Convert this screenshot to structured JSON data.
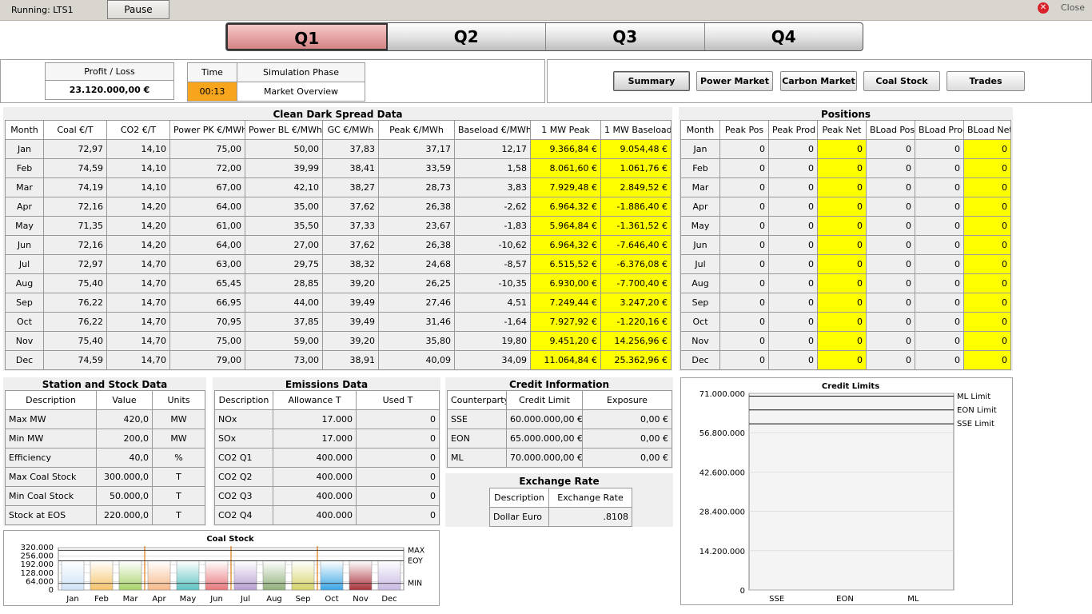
{
  "topbar": {
    "running_label": "Running:",
    "running_value": "LTS1",
    "pause_label": "Pause",
    "close_label": "Close"
  },
  "quarters": [
    "Q1",
    "Q2",
    "Q3",
    "Q4"
  ],
  "active_quarter": "Q1",
  "status": {
    "profit_label": "Profit / Loss",
    "profit_value": "23.120.000,00 €",
    "time_label": "Time",
    "time_value": "00:13",
    "phase_label": "Simulation Phase",
    "phase_value": "Market Overview"
  },
  "nav": [
    "Summary",
    "Power Market",
    "Carbon Market",
    "Coal Stock",
    "Trades"
  ],
  "spread": {
    "title": "Clean Dark Spread Data",
    "headers": [
      "Month",
      "Coal €/T",
      "CO2 €/T",
      "Power PK €/MWh",
      "Power BL €/MWh",
      "GC €/MWh",
      "Peak €/MWh",
      "Baseload €/MWh",
      "1 MW Peak",
      "1 MW Baseload"
    ],
    "rows": [
      [
        "Jan",
        "72,97",
        "14,10",
        "75,00",
        "50,00",
        "37,83",
        "37,17",
        "12,17",
        "9.366,84 €",
        "9.054,48 €"
      ],
      [
        "Feb",
        "74,59",
        "14,10",
        "72,00",
        "39,99",
        "38,41",
        "33,59",
        "1,58",
        "8.061,60 €",
        "1.061,76 €"
      ],
      [
        "Mar",
        "74,19",
        "14,10",
        "67,00",
        "42,10",
        "38,27",
        "28,73",
        "3,83",
        "7.929,48 €",
        "2.849,52 €"
      ],
      [
        "Apr",
        "72,16",
        "14,20",
        "64,00",
        "35,00",
        "37,62",
        "26,38",
        "-2,62",
        "6.964,32 €",
        "-1.886,40 €"
      ],
      [
        "May",
        "71,35",
        "14,20",
        "61,00",
        "35,50",
        "37,33",
        "23,67",
        "-1,83",
        "5.964,84 €",
        "-1.361,52 €"
      ],
      [
        "Jun",
        "72,16",
        "14,20",
        "64,00",
        "27,00",
        "37,62",
        "26,38",
        "-10,62",
        "6.964,32 €",
        "-7.646,40 €"
      ],
      [
        "Jul",
        "72,97",
        "14,70",
        "63,00",
        "29,75",
        "38,32",
        "24,68",
        "-8,57",
        "6.515,52 €",
        "-6.376,08 €"
      ],
      [
        "Aug",
        "75,40",
        "14,70",
        "65,45",
        "28,85",
        "39,20",
        "26,25",
        "-10,35",
        "6.930,00 €",
        "-7.700,40 €"
      ],
      [
        "Sep",
        "76,22",
        "14,70",
        "66,95",
        "44,00",
        "39,49",
        "27,46",
        "4,51",
        "7.249,44 €",
        "3.247,20 €"
      ],
      [
        "Oct",
        "76,22",
        "14,70",
        "70,95",
        "37,85",
        "39,49",
        "31,46",
        "-1,64",
        "7.927,92 €",
        "-1.220,16 €"
      ],
      [
        "Nov",
        "75,40",
        "14,70",
        "75,00",
        "59,00",
        "39,20",
        "35,80",
        "19,80",
        "9.451,20 €",
        "14.256,96 €"
      ],
      [
        "Dec",
        "74,59",
        "14,70",
        "79,00",
        "73,00",
        "38,91",
        "40,09",
        "34,09",
        "11.064,84 €",
        "25.362,96 €"
      ]
    ]
  },
  "positions": {
    "title": "Positions",
    "headers": [
      "Month",
      "Peak Pos",
      "Peak Prod",
      "Peak Net",
      "BLoad Pos",
      "BLoad Prod",
      "BLoad Net"
    ],
    "rows": [
      [
        "Jan",
        "0",
        "0",
        "0",
        "0",
        "0",
        "0"
      ],
      [
        "Feb",
        "0",
        "0",
        "0",
        "0",
        "0",
        "0"
      ],
      [
        "Mar",
        "0",
        "0",
        "0",
        "0",
        "0",
        "0"
      ],
      [
        "Apr",
        "0",
        "0",
        "0",
        "0",
        "0",
        "0"
      ],
      [
        "May",
        "0",
        "0",
        "0",
        "0",
        "0",
        "0"
      ],
      [
        "Jun",
        "0",
        "0",
        "0",
        "0",
        "0",
        "0"
      ],
      [
        "Jul",
        "0",
        "0",
        "0",
        "0",
        "0",
        "0"
      ],
      [
        "Aug",
        "0",
        "0",
        "0",
        "0",
        "0",
        "0"
      ],
      [
        "Sep",
        "0",
        "0",
        "0",
        "0",
        "0",
        "0"
      ],
      [
        "Oct",
        "0",
        "0",
        "0",
        "0",
        "0",
        "0"
      ],
      [
        "Nov",
        "0",
        "0",
        "0",
        "0",
        "0",
        "0"
      ],
      [
        "Dec",
        "0",
        "0",
        "0",
        "0",
        "0",
        "0"
      ]
    ]
  },
  "station": {
    "title": "Station and Stock Data",
    "headers": [
      "Description",
      "Value",
      "Units"
    ],
    "rows": [
      [
        "Max MW",
        "420,0",
        "MW"
      ],
      [
        "Min MW",
        "200,0",
        "MW"
      ],
      [
        "Efficiency",
        "40,0",
        "%"
      ],
      [
        "Max Coal Stock",
        "300.000,0",
        "T"
      ],
      [
        "Min Coal Stock",
        "50.000,0",
        "T"
      ],
      [
        "Stock at EOS",
        "220.000,0",
        "T"
      ]
    ]
  },
  "emissions": {
    "title": "Emissions Data",
    "headers": [
      "Description",
      "Allowance T",
      "Used T"
    ],
    "rows": [
      [
        "NOx",
        "17.000",
        "0"
      ],
      [
        "SOx",
        "17.000",
        "0"
      ],
      [
        "CO2 Q1",
        "400.000",
        "0"
      ],
      [
        "CO2 Q2",
        "400.000",
        "0"
      ],
      [
        "CO2 Q3",
        "400.000",
        "0"
      ],
      [
        "CO2 Q4",
        "400.000",
        "0"
      ]
    ]
  },
  "credit": {
    "title": "Credit Information",
    "headers": [
      "Counterparty",
      "Credit Limit",
      "Exposure"
    ],
    "rows": [
      [
        "SSE",
        "60.000.000,00 €",
        "0,00 €"
      ],
      [
        "EON",
        "65.000.000,00 €",
        "0,00 €"
      ],
      [
        "ML",
        "70.000.000,00 €",
        "0,00 €"
      ]
    ]
  },
  "exchange": {
    "title": "Exchange Rate",
    "headers": [
      "Description",
      "Exchange Rate"
    ],
    "rows": [
      [
        "Dollar Euro",
        ".8108"
      ]
    ]
  },
  "chart_data": [
    {
      "type": "bar",
      "title": "Coal Stock",
      "categories": [
        "Jan",
        "Feb",
        "Mar",
        "Apr",
        "May",
        "Jun",
        "Jul",
        "Aug",
        "Sep",
        "Oct",
        "Nov",
        "Dec"
      ],
      "values": [
        220000,
        220000,
        220000,
        220000,
        220000,
        220000,
        220000,
        220000,
        220000,
        220000,
        220000,
        220000
      ],
      "ytick_labels": [
        "320.000",
        "256.000",
        "192.000",
        "128.000",
        "64.000",
        "0"
      ],
      "ylim": [
        0,
        320000
      ],
      "reference_lines": [
        {
          "name": "MAX",
          "value": 300000
        },
        {
          "name": "EOY",
          "value": 220000
        },
        {
          "name": "MIN",
          "value": 50000
        }
      ],
      "bar_colors": [
        "#cfe3f7",
        "#f5c46a",
        "#a8d36a",
        "#f7b98a",
        "#5fc3c3",
        "#e8777b",
        "#b89fd1",
        "#8fb07a",
        "#d6d46a",
        "#3ba6e6",
        "#a8323b",
        "#c9b9e3"
      ],
      "quarter_separators_after": [
        "Mar",
        "Jun",
        "Sep"
      ]
    },
    {
      "type": "bar",
      "title": "Credit Limits",
      "categories": [
        "SSE",
        "EON",
        "ML"
      ],
      "values": [
        0,
        0,
        0
      ],
      "ytick_labels": [
        "71.000.000",
        "56.800.000",
        "42.600.000",
        "28.400.000",
        "14.200.000",
        "0"
      ],
      "ylim": [
        0,
        71000000
      ],
      "reference_lines": [
        {
          "name": "ML Limit",
          "value": 70000000
        },
        {
          "name": "EON Limit",
          "value": 65000000
        },
        {
          "name": "SSE Limit",
          "value": 60000000
        }
      ]
    }
  ]
}
